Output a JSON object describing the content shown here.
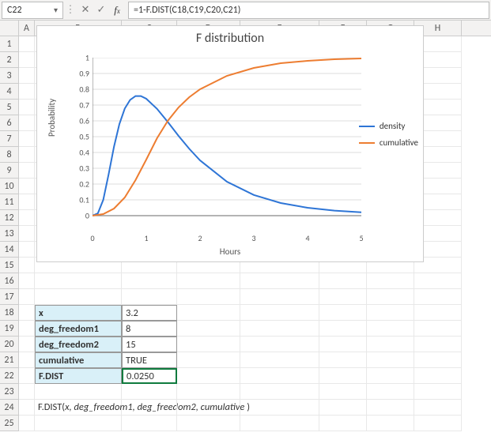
{
  "formula_bar": {
    "cell_ref": "C22",
    "formula": "=1-F.DIST(C18,C19,C20,C21)"
  },
  "columns": [
    "A",
    "B",
    "C",
    "D",
    "E",
    "F",
    "G",
    "H"
  ],
  "row_count": 25,
  "params": {
    "r18_label": "x",
    "r18_val": "3.2",
    "r19_label": "deg_freedom1",
    "r19_val": "8",
    "r20_label": "deg_freedom2",
    "r20_val": "15",
    "r21_label": "cumulative",
    "r21_val": "TRUE",
    "r22_label": "F.DIST",
    "r22_val": "0.0250"
  },
  "syntax_line": {
    "fn": "F.DIST(",
    "args": "x, deg_freedom1, deg_freedom2, cumulative",
    "close": ")"
  },
  "chart_data": {
    "type": "line",
    "title": "F distribution",
    "xlabel": "Hours",
    "ylabel": "Probability",
    "x_ticks": [
      0,
      1,
      2,
      3,
      4,
      5
    ],
    "y_ticks": [
      0,
      0.1,
      0.2,
      0.3,
      0.4,
      0.5,
      0.6,
      0.7,
      0.8,
      0.9,
      1
    ],
    "xlim": [
      0,
      5
    ],
    "ylim": [
      0,
      1
    ],
    "series": [
      {
        "name": "density",
        "color": "#2e75d6",
        "x": [
          0,
          0.1,
          0.2,
          0.3,
          0.4,
          0.5,
          0.6,
          0.7,
          0.8,
          0.9,
          1.0,
          1.2,
          1.4,
          1.6,
          1.8,
          2.0,
          2.5,
          3.0,
          3.5,
          4.0,
          4.5,
          5.0
        ],
        "y": [
          0,
          0.015,
          0.1,
          0.262,
          0.437,
          0.58,
          0.678,
          0.733,
          0.757,
          0.757,
          0.74,
          0.676,
          0.593,
          0.505,
          0.423,
          0.35,
          0.215,
          0.131,
          0.08,
          0.05,
          0.032,
          0.021
        ]
      },
      {
        "name": "cumulative",
        "color": "#ed7d31",
        "x": [
          0,
          0.2,
          0.4,
          0.6,
          0.8,
          1.0,
          1.2,
          1.4,
          1.6,
          1.8,
          2.0,
          2.5,
          3.0,
          3.5,
          4.0,
          4.5,
          5.0
        ],
        "y": [
          0,
          0.01,
          0.045,
          0.115,
          0.225,
          0.355,
          0.49,
          0.6,
          0.685,
          0.75,
          0.8,
          0.885,
          0.935,
          0.965,
          0.98,
          0.99,
          0.995
        ]
      }
    ]
  },
  "legend": {
    "density": "density",
    "cumulative": "cumulative"
  }
}
